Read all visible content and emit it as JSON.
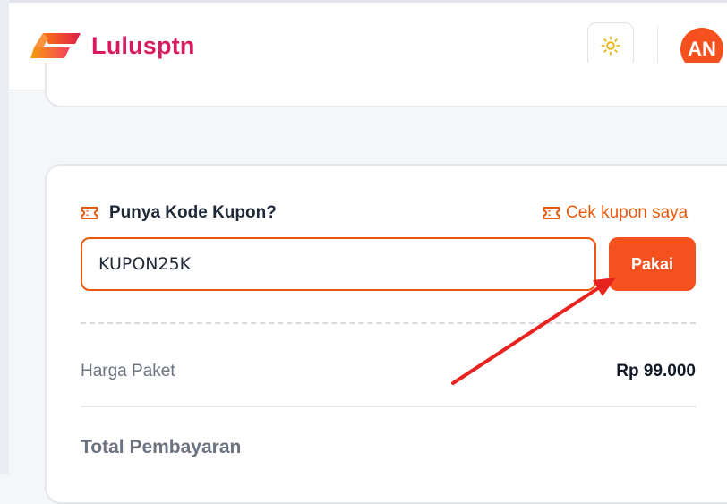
{
  "header": {
    "brand": "Lulusptn",
    "avatar_initials": "AN",
    "theme_icon": "sun-icon"
  },
  "coupon": {
    "title": "Punya Kode Kupon?",
    "icon": "ticket-icon",
    "check_link": "Cek kupon saya",
    "input_value": "KUPON25K",
    "apply_label": "Pakai"
  },
  "summary": {
    "price_label": "Harga Paket",
    "price_value": "Rp 99.000",
    "total_label": "Total Pembayaran"
  },
  "colors": {
    "accent": "#f4511e",
    "brand_text": "#d81b60",
    "annotation_arrow": "#e8231f"
  }
}
